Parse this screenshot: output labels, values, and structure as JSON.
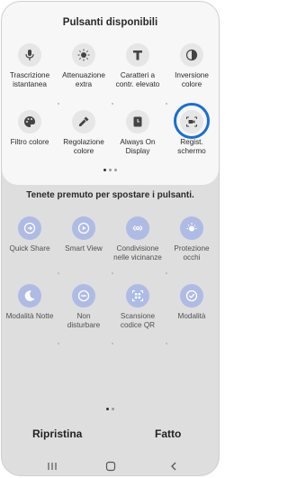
{
  "available": {
    "title": "Pulsanti disponibili",
    "items": [
      {
        "label": "Trascrizione\nistantanea",
        "icon": "mic-icon"
      },
      {
        "label": "Attenuazione\nextra",
        "icon": "brightness-icon"
      },
      {
        "label": "Caratteri a\ncontr. elevato",
        "icon": "font-contrast-icon"
      },
      {
        "label": "Inversione\ncolore",
        "icon": "invert-icon"
      },
      {
        "label": "Filtro colore",
        "icon": "palette-icon"
      },
      {
        "label": "Regolazione\ncolore",
        "icon": "eyedropper-icon"
      },
      {
        "label": "Always On\nDisplay",
        "icon": "clock-icon"
      },
      {
        "label": "Regist.\nschermo",
        "icon": "screen-record-icon"
      }
    ]
  },
  "active": {
    "title": "Tenete premuto per spostare i pulsanti.",
    "items": [
      {
        "label": "Quick Share",
        "icon": "quick-share-icon"
      },
      {
        "label": "Smart View",
        "icon": "smart-view-icon"
      },
      {
        "label": "Condivisione\nnelle vicinanze",
        "icon": "nearby-share-icon"
      },
      {
        "label": "Protezione\nocchi",
        "icon": "eye-comfort-icon"
      },
      {
        "label": "Modalità Notte",
        "icon": "moon-icon"
      },
      {
        "label": "Non\ndisturbare",
        "icon": "do-not-disturb-icon"
      },
      {
        "label": "Scansione\ncodice QR",
        "icon": "qr-icon"
      },
      {
        "label": "Modalità",
        "icon": "modes-icon"
      }
    ]
  },
  "actions": {
    "reset": "Ripristina",
    "done": "Fatto"
  },
  "colors": {
    "highlight": "#1a6fd0",
    "active_icon_bg": "#aebbe5"
  }
}
